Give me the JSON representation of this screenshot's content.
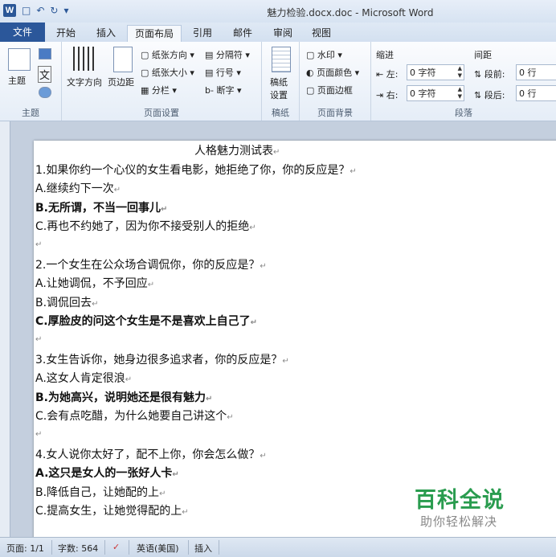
{
  "window": {
    "title": "魅力检验.docx.doc - Microsoft Word"
  },
  "tabs": [
    "文件",
    "开始",
    "插入",
    "页面布局",
    "引用",
    "邮件",
    "审阅",
    "视图"
  ],
  "ribbon": {
    "theme": {
      "label": "主题",
      "group": "主题",
      "colors": "文"
    },
    "page_setup": {
      "text_direction": "文字方向",
      "margins": "页边距",
      "orientation": "纸张方向",
      "size": "纸张大小",
      "columns": "分栏",
      "breaks": "分隔符",
      "line_numbers": "行号",
      "hyphenation": "断字",
      "group": "页面设置"
    },
    "draft": {
      "label1": "稿纸",
      "label2": "设置",
      "group": "稿纸"
    },
    "background": {
      "watermark": "水印",
      "page_color": "页面颜色",
      "page_borders": "页面边框",
      "group": "页面背景"
    },
    "paragraph": {
      "indent_label": "缩进",
      "spacing_label": "间距",
      "left_label": "左:",
      "left_value": "0 字符",
      "right_label": "右:",
      "right_value": "0 字符",
      "before_label": "段前:",
      "before_value": "0 行",
      "after_label": "段后:",
      "after_value": "0 行",
      "group": "段落"
    }
  },
  "document": {
    "lines": [
      {
        "text": "人格魅力测试表",
        "bold": false,
        "center": true
      },
      {
        "text": "1.如果你约一个心仪的女生看电影，她拒绝了你，你的反应是？",
        "bold": false
      },
      {
        "text": "A.继续约下一次",
        "bold": false
      },
      {
        "text": "B.无所谓，不当一回事儿",
        "bold": true
      },
      {
        "text": "C.再也不约她了，因为你不接受别人的拒绝",
        "bold": false
      },
      {
        "text": "",
        "bold": false
      },
      {
        "text": "2.一个女生在公众场合调侃你，你的反应是？",
        "bold": false
      },
      {
        "text": "A.让她调侃，不予回应",
        "bold": false
      },
      {
        "text": "B.调侃回去",
        "bold": false
      },
      {
        "text": "C.厚脸皮的问这个女生是不是喜欢上自己了",
        "bold": true
      },
      {
        "text": "",
        "bold": false
      },
      {
        "text": "3.女生告诉你，她身边很多追求者，你的反应是？",
        "bold": false
      },
      {
        "text": "A.这女人肯定很浪",
        "bold": false
      },
      {
        "text": "B.为她高兴，说明她还是很有魅力",
        "bold": true
      },
      {
        "text": "C.会有点吃醋，为什么她要自己讲这个",
        "bold": false
      },
      {
        "text": "",
        "bold": false
      },
      {
        "text": "4.女人说你太好了，配不上你，你会怎么做？",
        "bold": false
      },
      {
        "text": "A.这只是女人的一张好人卡",
        "bold": true
      },
      {
        "text": "B.降低自己，让她配的上",
        "bold": false
      },
      {
        "text": "C.提高女生，让她觉得配的上",
        "bold": false
      }
    ]
  },
  "status": {
    "page": "页面: 1/1",
    "words": "字数: 564",
    "language": "英语(美国)",
    "mode": "插入"
  },
  "watermark": {
    "title": "百科全说",
    "subtitle": "助你轻松解决"
  }
}
